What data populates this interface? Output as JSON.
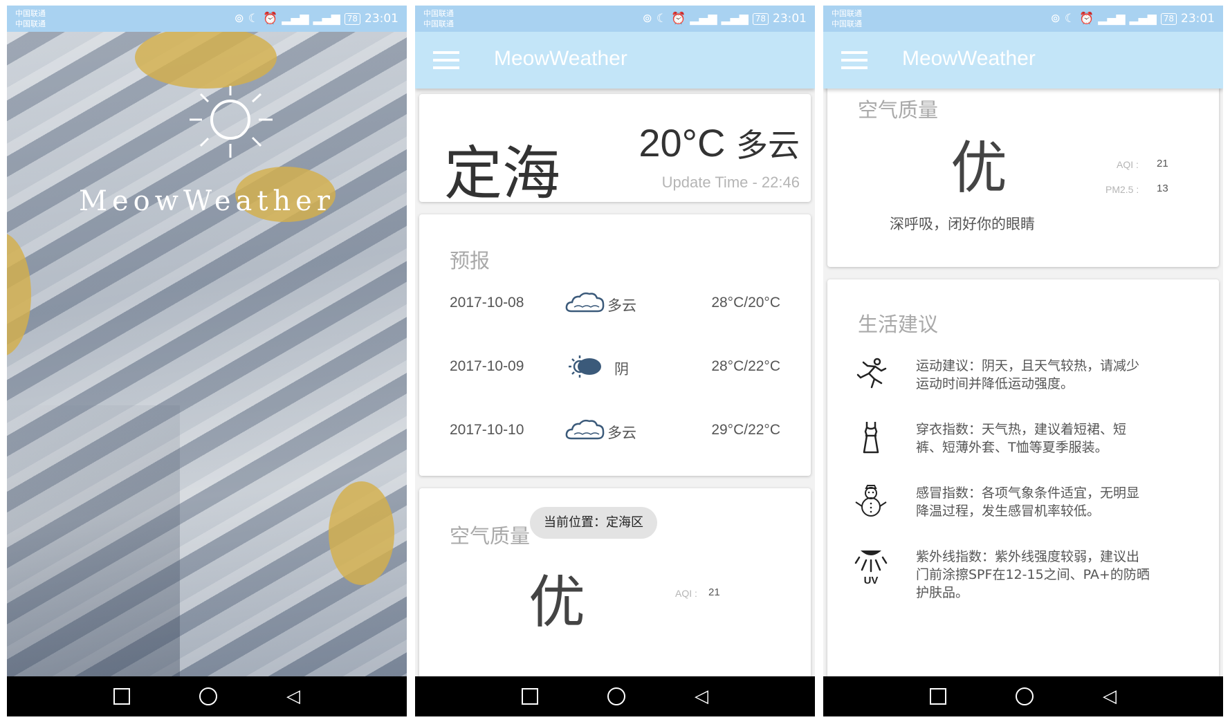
{
  "status_bar": {
    "carrier_1": "中国联通",
    "carrier_2": "中国联通",
    "battery": "78",
    "time": "23:01"
  },
  "splash": {
    "title": "MeowWeather"
  },
  "app": {
    "title": "MeowWeather"
  },
  "now": {
    "city": "定海",
    "temperature": "20°C",
    "condition": "多云",
    "update_time": "Update Time - 22:46"
  },
  "forecast": {
    "title": "预报",
    "days": [
      {
        "date": "2017-10-08",
        "icon": "cloudy-icon",
        "condition": "多云",
        "range": "28°C/20°C"
      },
      {
        "date": "2017-10-09",
        "icon": "overcast-icon",
        "condition": "阴",
        "range": "28°C/22°C"
      },
      {
        "date": "2017-10-10",
        "icon": "cloudy-icon",
        "condition": "多云",
        "range": "29°C/22°C"
      }
    ]
  },
  "aqi": {
    "title": "空气质量",
    "quality": "优",
    "aqi_label": "AQI :",
    "aqi_value": "21",
    "pm25_label": "PM2.5 :",
    "pm25_value": "13",
    "tip": "深呼吸，闭好你的眼睛"
  },
  "toast": "当前位置：定海区",
  "suggestion": {
    "title": "生活建议",
    "items": [
      {
        "icon": "running-person-icon",
        "text": "运动建议：阴天，且天气较热，请减少运动时间并降低运动强度。"
      },
      {
        "icon": "dress-icon",
        "text": "穿衣指数：天气热，建议着短裙、短裤、短薄外套、T恤等夏季服装。"
      },
      {
        "icon": "snowman-icon",
        "text": "感冒指数：各项气象条件适宜，无明显降温过程，发生感冒机率较低。"
      },
      {
        "icon": "uv-icon",
        "text": "紫外线指数：紫外线强度较弱，建议出门前涂擦SPF在12-15之间、PA+的防晒护肤品。"
      }
    ]
  },
  "colors": {
    "status_bar": "#a9d2f1",
    "app_bar": "#c3e5f8",
    "icon_blue": "#3b5a7a"
  }
}
